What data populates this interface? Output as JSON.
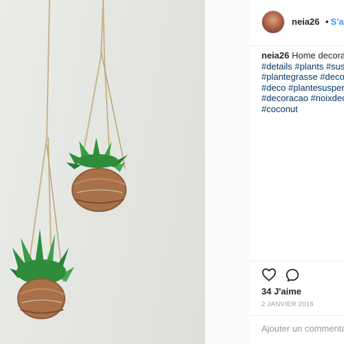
{
  "photo": {
    "alt": "Hanging coconut planters with succulents"
  },
  "header": {
    "username": "neia26",
    "separator": "•",
    "follow_label": "S'abonner"
  },
  "caption": {
    "username": "neia26",
    "text": "Home decoration",
    "hashtags_line1": "#details #plants #suspension",
    "hashtags_line2": "#plantegrasse #decoration",
    "hashtags_line3": "#deco #plantesuspendue",
    "hashtags_line4": "#decoracao #noixdecoco",
    "hashtags_line5": "#coconut"
  },
  "actions": {
    "like_icon": "heart-icon",
    "comment_icon": "comment-icon"
  },
  "likes": "34 J'aime",
  "date": "2 JANVIER 2016",
  "comment_input": {
    "placeholder": "Ajouter un commentaire..."
  }
}
